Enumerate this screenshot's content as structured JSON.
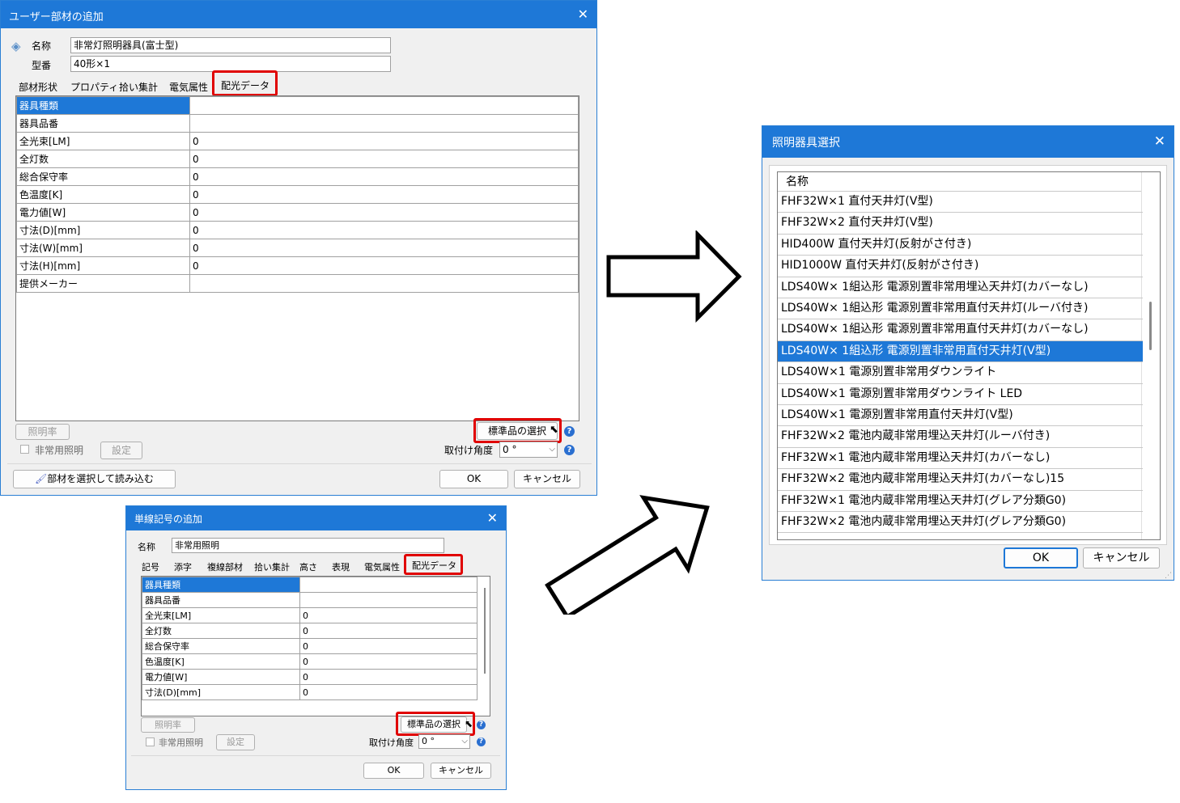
{
  "dialog1": {
    "title": "ユーザー部材の追加",
    "name_label": "名称",
    "name_value": "非常灯照明器具(富士型)",
    "model_label": "型番",
    "model_value": "40形×1",
    "tabs": [
      "部材形状",
      "プロパティ",
      "拾い集計",
      "電気属性",
      "配光データ"
    ],
    "rows": [
      {
        "key": "器具種類",
        "value": ""
      },
      {
        "key": "器具品番",
        "value": ""
      },
      {
        "key": "全光束[LM]",
        "value": "0"
      },
      {
        "key": "全灯数",
        "value": "0"
      },
      {
        "key": "総合保守率",
        "value": "0"
      },
      {
        "key": "色温度[K]",
        "value": "0"
      },
      {
        "key": "電力値[W]",
        "value": "0"
      },
      {
        "key": "寸法(D)[mm]",
        "value": "0"
      },
      {
        "key": "寸法(W)[mm]",
        "value": "0"
      },
      {
        "key": "寸法(H)[mm]",
        "value": "0"
      },
      {
        "key": "提供メーカー",
        "value": ""
      }
    ],
    "illuminance_label": "照明率",
    "standard_select_label": "標準品の選択",
    "emergency_label": "非常用照明",
    "settings_label": "設定",
    "mount_angle_label": "取付け角度",
    "mount_angle_value": "0 °",
    "load_part_label": "部材を選択して読み込む",
    "ok_label": "OK",
    "cancel_label": "キャンセル"
  },
  "dialog2": {
    "title": "単線記号の追加",
    "name_label": "名称",
    "name_value": "非常用照明",
    "tabs": [
      "記号",
      "添字",
      "複線部材",
      "拾い集計",
      "高さ",
      "表現",
      "電気属性",
      "配光データ"
    ],
    "rows": [
      {
        "key": "器具種類",
        "value": ""
      },
      {
        "key": "器具品番",
        "value": ""
      },
      {
        "key": "全光束[LM]",
        "value": "0"
      },
      {
        "key": "全灯数",
        "value": "0"
      },
      {
        "key": "総合保守率",
        "value": "0"
      },
      {
        "key": "色温度[K]",
        "value": "0"
      },
      {
        "key": "電力値[W]",
        "value": "0"
      },
      {
        "key": "寸法(D)[mm]",
        "value": "0"
      }
    ],
    "illuminance_label": "照明率",
    "standard_select_label": "標準品の選択",
    "emergency_label": "非常用照明",
    "settings_label": "設定",
    "mount_angle_label": "取付け角度",
    "mount_angle_value": "0 °",
    "ok_label": "OK",
    "cancel_label": "キャンセル"
  },
  "dialog3": {
    "title": "照明器具選択",
    "column_header": "名称",
    "items": [
      "FHF32W×1 直付天井灯(V型)",
      "FHF32W×2 直付天井灯(V型)",
      "HID400W 直付天井灯(反射がさ付き)",
      "HID1000W 直付天井灯(反射がさ付き)",
      "LDS40W× 1組込形 電源別置非常用埋込天井灯(カバーなし)",
      "LDS40W× 1組込形 電源別置非常用直付天井灯(ルーバ付き)",
      "LDS40W× 1組込形 電源別置非常用直付天井灯(カバーなし)",
      "LDS40W× 1組込形 電源別置非常用直付天井灯(V型)",
      "LDS40W×1 電源別置非常用ダウンライト",
      "LDS40W×1 電源別置非常用ダウンライト LED",
      "LDS40W×1 電源別置非常用直付天井灯(V型)",
      "FHF32W×2 電池内蔵非常用埋込天井灯(ルーバ付き)",
      "FHF32W×1 電池内蔵非常用埋込天井灯(カバーなし)",
      "FHF32W×2 電池内蔵非常用埋込天井灯(カバーなし)15",
      "FHF32W×1 電池内蔵非常用埋込天井灯(グレア分類G0)",
      "FHF32W×2 電池内蔵非常用埋込天井灯(グレア分類G0)"
    ],
    "selected_index": 7,
    "ok_label": "OK",
    "cancel_label": "キャンセル"
  },
  "accent_color": "#1e78d7",
  "highlight_color": "#e00000"
}
